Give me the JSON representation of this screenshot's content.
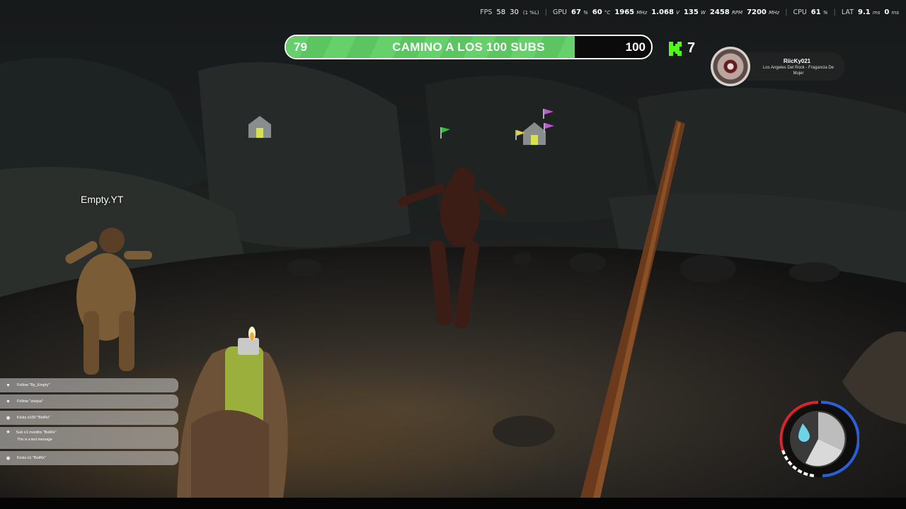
{
  "perf": {
    "fps_label": "FPS",
    "fps": "58",
    "fps_low": "30",
    "fps_low_note": "(1 %L)",
    "gpu_label": "GPU",
    "gpu_load": "67",
    "gpu_temp": "60",
    "gpu_clock": "1965",
    "gpu_volt": "1.068",
    "gpu_power": "135",
    "gpu_fan": "2458",
    "gpu_mem": "7200",
    "cpu_label": "CPU",
    "cpu_load": "61",
    "lat_label": "LAT",
    "lat_a": "9.1",
    "lat_b": "0",
    "u_pct": "%",
    "u_temp": "°C",
    "u_mhz": "MHz",
    "u_v": "V",
    "u_w": "W",
    "u_rpm": "RPM",
    "u_ms": "ms"
  },
  "subs_goal": {
    "current": "79",
    "goal": "100",
    "title": "CAMINO A LOS 100 SUBS",
    "progress": 0.79,
    "color": "#66d06a"
  },
  "kick": {
    "count": "7",
    "icon": "kick-logo-icon",
    "color": "#53fc18"
  },
  "now_playing": {
    "user": "RiicKy021",
    "song": "Los Angeles Del Rock - Fragancia De Mujer"
  },
  "player_name": "Empty.YT",
  "feed": [
    {
      "icon": "heart-icon",
      "text": "Follow \"By_Empty\""
    },
    {
      "icon": "heart-icon",
      "text": "Follow \"zoejus\""
    },
    {
      "icon": "kick-icon",
      "text": "Kicks x100 \"BotRx\""
    },
    {
      "icon": "star-icon",
      "text": "Sub x1 months \"BotRx\"",
      "sub": "This is a test message"
    },
    {
      "icon": "kick-icon",
      "text": "Kicks x1 \"BotRx\""
    }
  ],
  "gauge": {
    "ring_colors": [
      "#d8262b",
      "#ffffff",
      "#2b5fd9"
    ],
    "water_icon": "water-drop-icon"
  }
}
